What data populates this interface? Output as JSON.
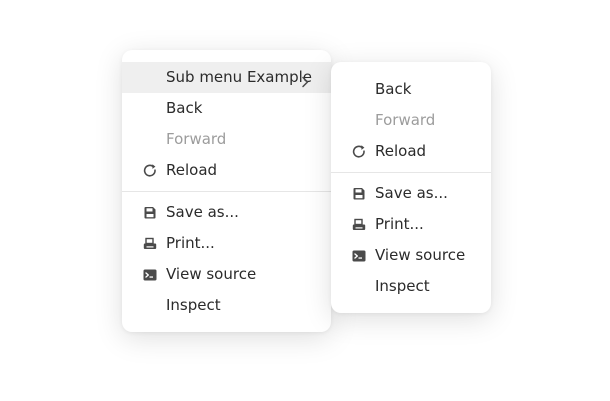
{
  "main_menu": {
    "items": [
      {
        "label": "Sub menu Example",
        "has_submenu": true
      },
      {
        "label": "Back"
      },
      {
        "label": "Forward",
        "disabled": true
      },
      {
        "label": "Reload",
        "icon": "reload-icon"
      },
      {
        "label": "Save as...",
        "icon": "save-icon"
      },
      {
        "label": "Print...",
        "icon": "print-icon"
      },
      {
        "label": "View source",
        "icon": "terminal-icon"
      },
      {
        "label": "Inspect"
      }
    ]
  },
  "sub_menu": {
    "items": [
      {
        "label": "Back"
      },
      {
        "label": "Forward",
        "disabled": true
      },
      {
        "label": "Reload",
        "icon": "reload-icon"
      },
      {
        "label": "Save as...",
        "icon": "save-icon"
      },
      {
        "label": "Print...",
        "icon": "print-icon"
      },
      {
        "label": "View source",
        "icon": "terminal-icon"
      },
      {
        "label": "Inspect"
      }
    ]
  },
  "colors": {
    "text": "#2b2b2b",
    "disabled_text": "#9c9c9c",
    "highlight": "#efefef",
    "icon": "#4a4a4a"
  }
}
